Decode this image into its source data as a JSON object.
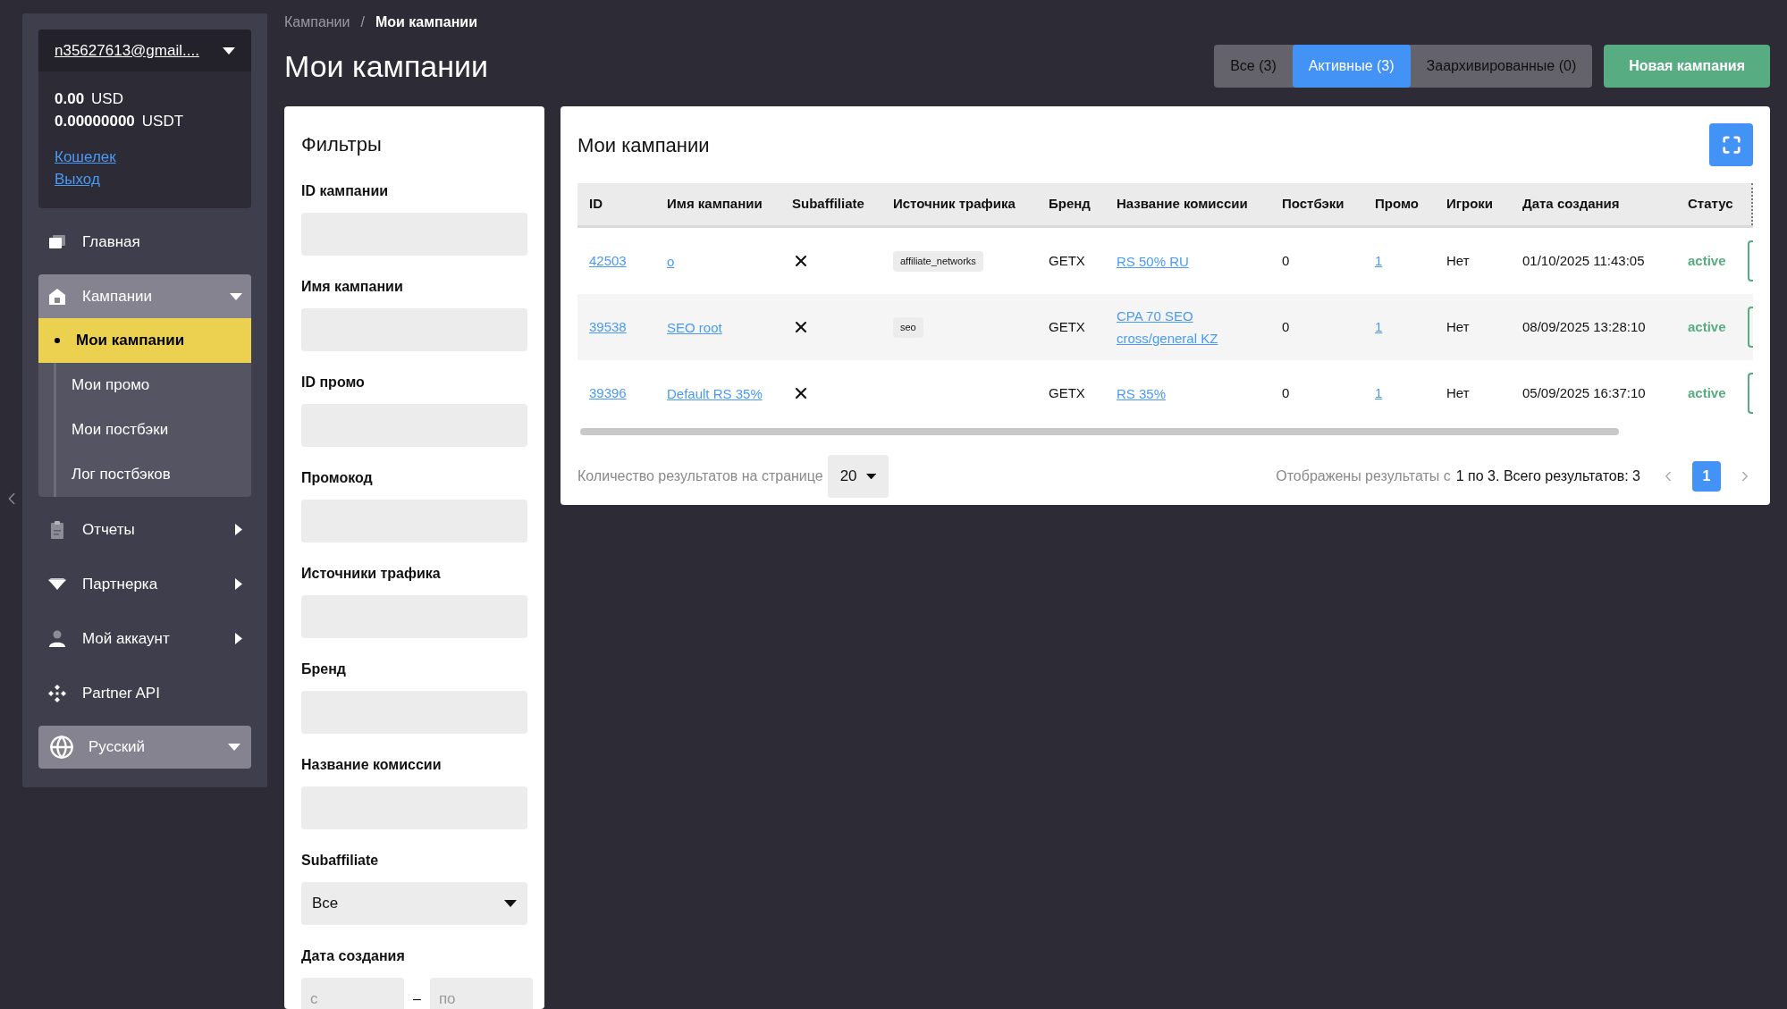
{
  "account": {
    "email": "n35627613@gmail....",
    "balances": [
      {
        "amount": "0.00",
        "currency": "USD"
      },
      {
        "amount": "0.00000000",
        "currency": "USDT"
      }
    ],
    "links": [
      "Кошелек",
      "Выход"
    ]
  },
  "nav": [
    {
      "kind": "link",
      "label": "Главная"
    },
    {
      "kind": "group",
      "label": "Кампании",
      "expanded": true,
      "children": [
        {
          "label": "Мои кампании",
          "selected": true
        },
        {
          "label": "Мои промо",
          "selected": false
        },
        {
          "label": "Мои постбэки",
          "selected": false
        },
        {
          "label": "Лог постбэков",
          "selected": false
        }
      ]
    },
    {
      "kind": "submenu",
      "label": "Отчеты"
    },
    {
      "kind": "submenu",
      "label": "Партнерка"
    },
    {
      "kind": "submenu",
      "label": "Мой аккаунт"
    },
    {
      "kind": "link",
      "label": "Partner API"
    }
  ],
  "language": "Русский",
  "breadcrumb": [
    "Кампании",
    "Мои кампании"
  ],
  "breadcrumb_separator": "/",
  "title": "Мои кампании",
  "tabs": [
    {
      "label": "Все (3)",
      "selected": false
    },
    {
      "label": "Активные (3)",
      "selected": true
    },
    {
      "label": "Заархивированные (0)",
      "selected": false
    }
  ],
  "new_button": "Новая кампания",
  "filters": {
    "title": "Фильтры",
    "fields": [
      {
        "kind": "text",
        "label": "ID кампании"
      },
      {
        "kind": "text",
        "label": "Имя кампании"
      },
      {
        "kind": "text",
        "label": "ID промо"
      },
      {
        "kind": "text",
        "label": "Промокод"
      },
      {
        "kind": "text",
        "label": "Источники трафика"
      },
      {
        "kind": "text",
        "label": "Бренд"
      },
      {
        "kind": "text",
        "label": "Название комиссии"
      },
      {
        "kind": "select",
        "label": "Subaffiliate",
        "value": "Все"
      },
      {
        "kind": "daterange",
        "label": "Дата создания",
        "from": {
          "placeholder": "с"
        },
        "separator": "–",
        "to": {
          "placeholder": "по"
        }
      }
    ]
  },
  "table": {
    "title": "Мои кампании",
    "columns": [
      "ID",
      "Имя кампании",
      "Subaffiliate",
      "Источник трафика",
      "Бренд",
      "Название комиссии",
      "Постбэки",
      "Промо",
      "Игроки",
      "Дата создания",
      "Статус"
    ],
    "rows": [
      {
        "id": "42503",
        "name": "o",
        "subaffiliate": false,
        "source": "affiliate_networks",
        "brand": "GETX",
        "commission": "RS 50% RU",
        "postbacks": "0",
        "promo": "1",
        "players": "Нет",
        "created": "01/10/2025 11:43:05",
        "status": "active"
      },
      {
        "id": "39538",
        "name": "SEO root",
        "subaffiliate": false,
        "source": "seo",
        "brand": "GETX",
        "commission": "CPA 70 SEO cross/general KZ",
        "postbacks": "0",
        "promo": "1",
        "players": "Нет",
        "created": "08/09/2025 13:28:10",
        "status": "active"
      },
      {
        "id": "39396",
        "name": "Default RS 35%",
        "subaffiliate": false,
        "brand": "GETX",
        "commission": "RS 35%",
        "postbacks": "0",
        "promo": "1",
        "players": "Нет",
        "created": "05/09/2025 16:37:10",
        "status": "active"
      }
    ],
    "per_page_label": "Количество результатов на странице",
    "per_page": "20",
    "results_prefix": "Отображены результаты с",
    "results_range": "1 по 3. Всего результатов: 3",
    "pages": [
      {
        "label": "1",
        "selected": true
      }
    ]
  }
}
